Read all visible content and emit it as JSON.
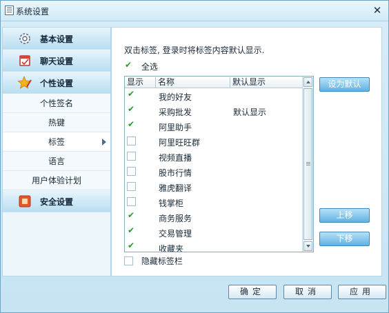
{
  "window": {
    "title": "系统设置"
  },
  "sidebar": {
    "categories": [
      {
        "label": "基本设置",
        "icon": "gear-icon"
      },
      {
        "label": "聊天设置",
        "icon": "chat-settings-icon"
      },
      {
        "label": "个性设置",
        "icon": "star-pen-icon"
      }
    ],
    "subitems": [
      {
        "label": "个性签名"
      },
      {
        "label": "热键"
      },
      {
        "label": "标签"
      },
      {
        "label": "语言"
      },
      {
        "label": "用户体验计划"
      }
    ],
    "bottom_category": {
      "label": "安全设置",
      "icon": "security-icon"
    }
  },
  "content": {
    "hint": "双击标签, 登录时将标签内容默认显示.",
    "select_all": {
      "label": "全选",
      "checked": true
    },
    "table": {
      "headers": [
        "显示",
        "名称",
        "默认显示"
      ],
      "rows": [
        {
          "checked": true,
          "name": "我的好友",
          "default": ""
        },
        {
          "checked": true,
          "name": "采购批发",
          "default": "默认显示"
        },
        {
          "checked": true,
          "name": "阿里助手",
          "default": ""
        },
        {
          "checked": false,
          "name": "阿里旺旺群",
          "default": ""
        },
        {
          "checked": false,
          "name": "视频直播",
          "default": ""
        },
        {
          "checked": false,
          "name": "股市行情",
          "default": ""
        },
        {
          "checked": false,
          "name": "雅虎翻译",
          "default": ""
        },
        {
          "checked": false,
          "name": "钱掌柜",
          "default": ""
        },
        {
          "checked": true,
          "name": "商务服务",
          "default": ""
        },
        {
          "checked": true,
          "name": "交易管理",
          "default": ""
        },
        {
          "checked": true,
          "name": "收藏夹",
          "default": ""
        }
      ]
    },
    "hide_tabs": {
      "label": "隐藏标签栏",
      "checked": false
    },
    "buttons": {
      "set_default": "设为默认",
      "move_up": "上移",
      "move_down": "下移"
    }
  },
  "footer": {
    "ok": "确定",
    "cancel": "取消",
    "apply": "应用"
  },
  "colors": {
    "accent": "#61b2e2",
    "check": "#2a9a2a",
    "panel_bg": "#c7e4f3"
  }
}
